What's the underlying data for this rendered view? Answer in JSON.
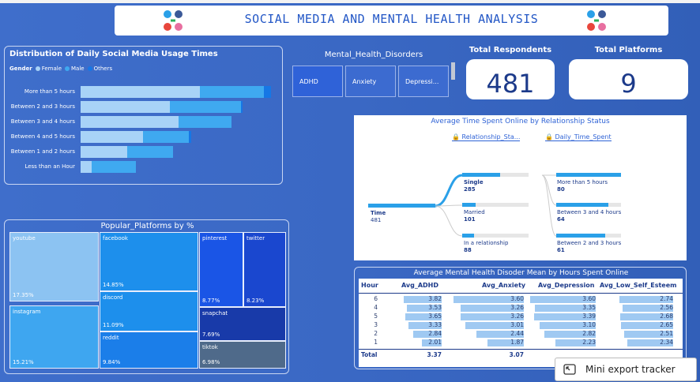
{
  "header": {
    "title": "SOCIAL MEDIA AND MENTAL HEALTH ANALYSIS"
  },
  "usage": {
    "title": "Distribution of Daily Social Media Usage Times",
    "legend": {
      "label": "Gender",
      "items": [
        {
          "name": "Female",
          "color": "#a8d3f7"
        },
        {
          "name": "Male",
          "color": "#3fa9f0"
        },
        {
          "name": "Others",
          "color": "#1677e5"
        }
      ]
    }
  },
  "slicer": {
    "title": "Mental_Health_Disorders",
    "options": [
      "ADHD",
      "Anxiety",
      "Depressi..."
    ]
  },
  "kpis": {
    "respondents": {
      "label": "Total Respondents",
      "value": "481"
    },
    "platforms": {
      "label": "Total Platforms",
      "value": "9"
    }
  },
  "relationship": {
    "title": "Average Time Spent Online by Relationship Status",
    "header1": "Relationship_Sta...",
    "header2": "Daily_Time_Spent",
    "root": {
      "label": "Time",
      "value": "481"
    },
    "level1": [
      {
        "label": "Single",
        "value": "285",
        "fill": 0.57
      },
      {
        "label": "Married",
        "value": "101",
        "fill": 0.2
      },
      {
        "label": "In a relationship",
        "value": "88",
        "fill": 0.18
      }
    ],
    "level2": [
      {
        "label": "More than 5 hours",
        "value": "80",
        "fill": 1.0
      },
      {
        "label": "Between 3 and 4 hours",
        "value": "64",
        "fill": 0.8
      },
      {
        "label": "Between 2 and 3 hours",
        "value": "61",
        "fill": 0.76
      }
    ]
  },
  "table": {
    "title": "Average Mental Health Disoder Mean by Hours Spent Online",
    "columns": [
      "Hour",
      "Avg_ADHD",
      "Avg_Anxiety",
      "Avg_Depression",
      "Avg_Low_Self_Esteem"
    ],
    "rows": [
      [
        "6",
        "3.82",
        "3.60",
        "3.60",
        "2.74"
      ],
      [
        "4",
        "3.53",
        "3.26",
        "3.35",
        "2.56"
      ],
      [
        "5",
        "3.65",
        "3.26",
        "3.39",
        "2.68"
      ],
      [
        "3",
        "3.33",
        "3.01",
        "3.10",
        "2.65"
      ],
      [
        "2",
        "2.84",
        "2.44",
        "2.82",
        "2.51"
      ],
      [
        "1",
        "2.01",
        "1.87",
        "2.23",
        "2.34"
      ]
    ],
    "total": [
      "Total",
      "3.37",
      "3.07",
      "",
      ""
    ]
  },
  "popup": {
    "label": "Mini export tracker"
  },
  "chart_data": [
    {
      "type": "bar",
      "title": "Distribution of Daily Social Media Usage Times",
      "orientation": "horizontal-stacked",
      "categories": [
        "More than 5 hours",
        "Between 2 and 3 hours",
        "Between 3 and 4 hours",
        "Between 4 and 5 hours",
        "Between 1 and 2 hours",
        "Less than an Hour"
      ],
      "series": [
        {
          "name": "Female",
          "values": [
            67,
            50,
            55,
            35,
            26,
            6
          ]
        },
        {
          "name": "Male",
          "values": [
            36,
            40,
            30,
            26,
            26,
            25
          ]
        },
        {
          "name": "Others",
          "values": [
            4,
            1,
            0,
            1,
            0,
            0
          ]
        }
      ]
    },
    {
      "type": "table",
      "title": "Popular_Platforms by %",
      "series": [
        {
          "name": "youtube",
          "value": "17.35%"
        },
        {
          "name": "instagram",
          "value": "15.21%"
        },
        {
          "name": "facebook",
          "value": "14.85%"
        },
        {
          "name": "discord",
          "value": "11.09%"
        },
        {
          "name": "reddit",
          "value": "9.84%"
        },
        {
          "name": "pinterest",
          "value": "8.77%"
        },
        {
          "name": "twitter",
          "value": "8.23%"
        },
        {
          "name": "snapchat",
          "value": "7.69%"
        },
        {
          "name": "tiktok",
          "value": "6.98%"
        }
      ]
    }
  ]
}
